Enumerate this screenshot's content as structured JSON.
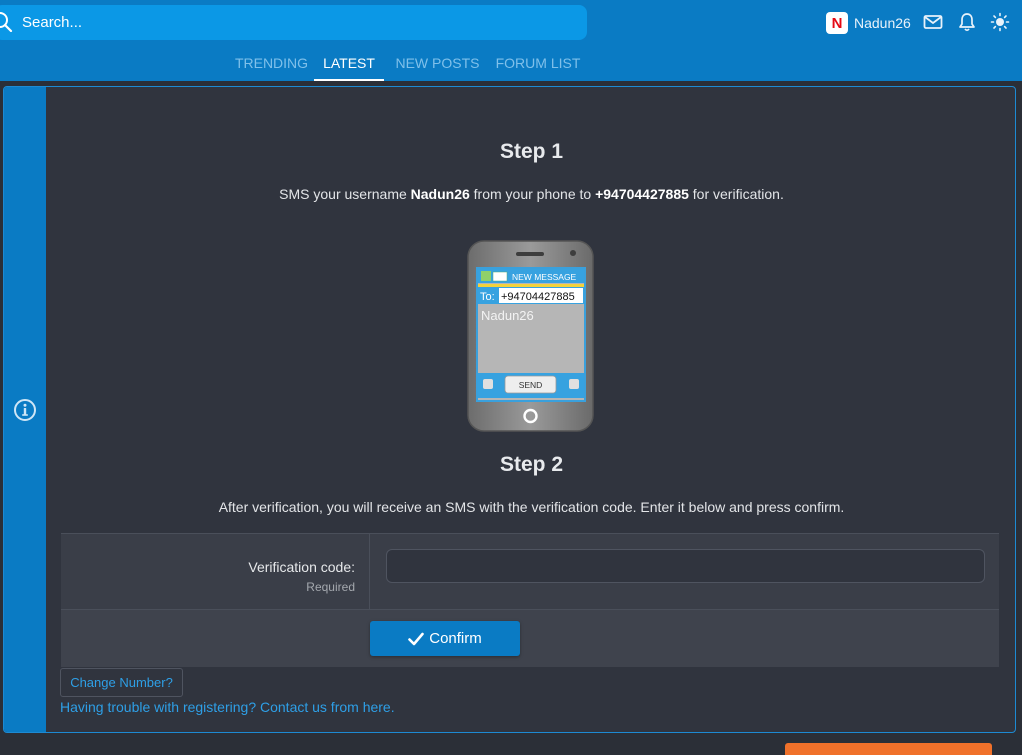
{
  "header": {
    "search": {
      "placeholder": "Search..."
    },
    "user": {
      "avatar_letter": "N",
      "username": "Nadun26"
    },
    "icons": [
      "search-icon",
      "mail-icon",
      "bell-icon",
      "theme-sun-icon"
    ],
    "nav": [
      {
        "label": "TRENDING",
        "active": false
      },
      {
        "label": "LATEST",
        "active": true
      },
      {
        "label": "NEW POSTS",
        "active": false
      },
      {
        "label": "FORUM LIST",
        "active": false
      }
    ]
  },
  "main": {
    "step1": {
      "title": "Step 1",
      "text_before": "SMS your username ",
      "username": "Nadun26",
      "text_middle": " from your phone to ",
      "phone_number": "+94704427885",
      "text_after": " for verification."
    },
    "phone_illustration": {
      "header": "NEW MESSAGE",
      "to_label": "To:",
      "to_number": "+94704427885",
      "message": "Nadun26",
      "send_label": "SEND"
    },
    "step2": {
      "title": "Step 2",
      "text": "After verification, you will receive an SMS with the verification code. Enter it below and press confirm."
    },
    "form": {
      "label": "Verification code:",
      "hint": "Required",
      "value": "",
      "confirm_label": "Confirm"
    },
    "change_number_label": "Change Number?",
    "trouble_link": "Having trouble with registering? Contact us from here."
  },
  "colors": {
    "header_bg": "#0a7bc4",
    "search_bg": "#0b98e6",
    "panel_bg": "#30343e",
    "link": "#2e9fe6",
    "accent_orange": "#f0712a"
  }
}
